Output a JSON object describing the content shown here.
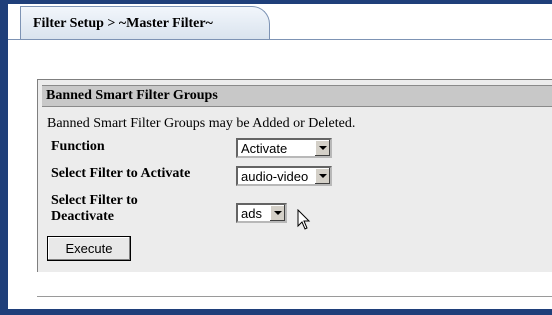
{
  "tab": {
    "title": "Filter Setup > ~Master Filter~"
  },
  "panel": {
    "title": "Banned Smart Filter Groups",
    "description": "Banned Smart Filter Groups may be Added or Deleted."
  },
  "form": {
    "function_label": "Function",
    "function_value": "Activate",
    "activate_label": "Select Filter to Activate",
    "activate_value": "audio-video",
    "deactivate_label": "Select Filter to Deactivate",
    "deactivate_value": "ads",
    "execute_label": "Execute"
  },
  "colors": {
    "frame": "#1f3f7a",
    "panel": "#ececec",
    "header": "#c8c8c8"
  }
}
